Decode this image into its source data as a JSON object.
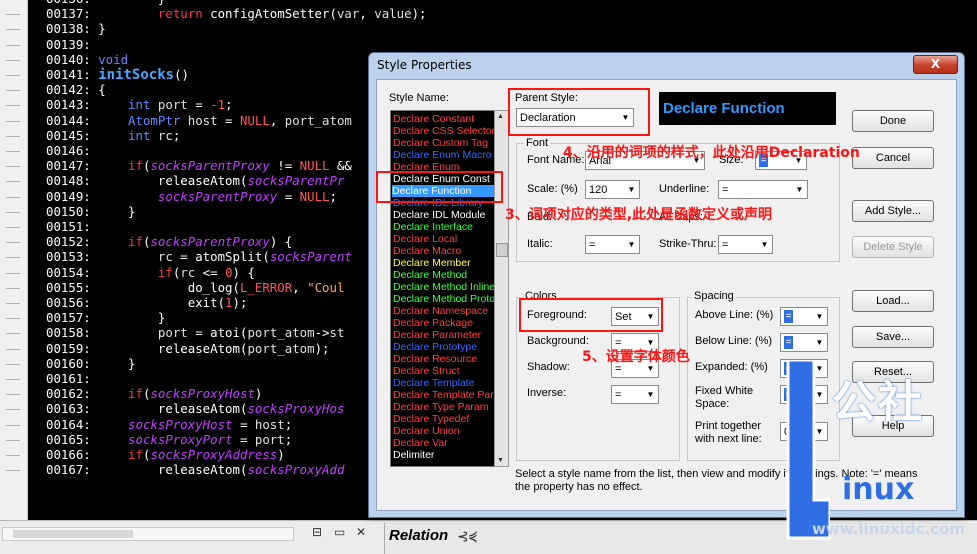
{
  "editor": {
    "lines": [
      {
        "n": "00136:",
        "parts": [
          {
            "c": "plain",
            "t": "        }"
          }
        ]
      },
      {
        "n": "00137:",
        "parts": [
          {
            "c": "kw",
            "t": "        return "
          },
          {
            "c": "fn",
            "t": "configAtomSetter"
          },
          {
            "c": "plain",
            "t": "("
          },
          {
            "c": "id",
            "t": "var"
          },
          {
            "c": "plain",
            "t": ", "
          },
          {
            "c": "id",
            "t": "value"
          },
          {
            "c": "plain",
            "t": ");"
          }
        ]
      },
      {
        "n": "00138:",
        "parts": [
          {
            "c": "plain",
            "t": "}"
          }
        ]
      },
      {
        "n": "00139:",
        "parts": [
          {
            "c": "plain",
            "t": ""
          }
        ]
      },
      {
        "n": "00140:",
        "parts": [
          {
            "c": "ty",
            "t": "void"
          }
        ]
      },
      {
        "n": "00141:",
        "parts": [
          {
            "c": "fdecl",
            "t": "initSocks"
          },
          {
            "c": "plain",
            "t": "()"
          }
        ]
      },
      {
        "n": "00142:",
        "parts": [
          {
            "c": "plain",
            "t": "{"
          }
        ]
      },
      {
        "n": "00143:",
        "parts": [
          {
            "c": "ty",
            "t": "    int "
          },
          {
            "c": "id",
            "t": "port"
          },
          {
            "c": "plain",
            "t": " = "
          },
          {
            "c": "num",
            "t": "-1"
          },
          {
            "c": "plain",
            "t": ";"
          }
        ]
      },
      {
        "n": "00144:",
        "parts": [
          {
            "c": "ty",
            "t": "    AtomPtr "
          },
          {
            "c": "id",
            "t": "host"
          },
          {
            "c": "plain",
            "t": " = "
          },
          {
            "c": "lit",
            "t": "NULL"
          },
          {
            "c": "plain",
            "t": ", "
          },
          {
            "c": "id",
            "t": "port_atom"
          }
        ]
      },
      {
        "n": "00145:",
        "parts": [
          {
            "c": "ty",
            "t": "    int "
          },
          {
            "c": "id",
            "t": "rc"
          },
          {
            "c": "plain",
            "t": ";"
          }
        ]
      },
      {
        "n": "00146:",
        "parts": [
          {
            "c": "plain",
            "t": ""
          }
        ]
      },
      {
        "n": "00147:",
        "parts": [
          {
            "c": "kw",
            "t": "    if"
          },
          {
            "c": "plain",
            "t": "("
          },
          {
            "c": "var",
            "t": "socksParentProxy"
          },
          {
            "c": "plain",
            "t": " != "
          },
          {
            "c": "lit",
            "t": "NULL"
          },
          {
            "c": "plain",
            "t": " &&"
          }
        ]
      },
      {
        "n": "00148:",
        "parts": [
          {
            "c": "fn",
            "t": "        releaseAtom"
          },
          {
            "c": "plain",
            "t": "("
          },
          {
            "c": "var",
            "t": "socksParentPr"
          }
        ]
      },
      {
        "n": "00149:",
        "parts": [
          {
            "c": "var",
            "t": "        socksParentProxy"
          },
          {
            "c": "plain",
            "t": " = "
          },
          {
            "c": "lit",
            "t": "NULL"
          },
          {
            "c": "plain",
            "t": ";"
          }
        ]
      },
      {
        "n": "00150:",
        "parts": [
          {
            "c": "plain",
            "t": "    }"
          }
        ]
      },
      {
        "n": "00151:",
        "parts": [
          {
            "c": "plain",
            "t": ""
          }
        ]
      },
      {
        "n": "00152:",
        "parts": [
          {
            "c": "kw",
            "t": "    if"
          },
          {
            "c": "plain",
            "t": "("
          },
          {
            "c": "var",
            "t": "socksParentProxy"
          },
          {
            "c": "plain",
            "t": ") {"
          }
        ]
      },
      {
        "n": "00153:",
        "parts": [
          {
            "c": "id",
            "t": "        rc"
          },
          {
            "c": "plain",
            "t": " = "
          },
          {
            "c": "fn",
            "t": "atomSplit"
          },
          {
            "c": "plain",
            "t": "("
          },
          {
            "c": "var",
            "t": "socksParent"
          }
        ]
      },
      {
        "n": "00154:",
        "parts": [
          {
            "c": "kw",
            "t": "        if"
          },
          {
            "c": "plain",
            "t": "("
          },
          {
            "c": "id",
            "t": "rc"
          },
          {
            "c": "plain",
            "t": " <= "
          },
          {
            "c": "num",
            "t": "0"
          },
          {
            "c": "plain",
            "t": ") {"
          }
        ]
      },
      {
        "n": "00155:",
        "parts": [
          {
            "c": "fn",
            "t": "            do_log"
          },
          {
            "c": "plain",
            "t": "("
          },
          {
            "c": "lit",
            "t": "L_ERROR"
          },
          {
            "c": "plain",
            "t": ", "
          },
          {
            "c": "str",
            "t": "\"Coul"
          }
        ]
      },
      {
        "n": "00156:",
        "parts": [
          {
            "c": "fn",
            "t": "            exit"
          },
          {
            "c": "plain",
            "t": "("
          },
          {
            "c": "num",
            "t": "1"
          },
          {
            "c": "plain",
            "t": ");"
          }
        ]
      },
      {
        "n": "00157:",
        "parts": [
          {
            "c": "plain",
            "t": "        }"
          }
        ]
      },
      {
        "n": "00158:",
        "parts": [
          {
            "c": "id",
            "t": "        port"
          },
          {
            "c": "plain",
            "t": " = "
          },
          {
            "c": "fn",
            "t": "atoi"
          },
          {
            "c": "plain",
            "t": "("
          },
          {
            "c": "id",
            "t": "port_atom"
          },
          {
            "c": "plain",
            "t": "->"
          },
          {
            "c": "id",
            "t": "st"
          }
        ]
      },
      {
        "n": "00159:",
        "parts": [
          {
            "c": "fn",
            "t": "        releaseAtom"
          },
          {
            "c": "plain",
            "t": "("
          },
          {
            "c": "id",
            "t": "port_atom"
          },
          {
            "c": "plain",
            "t": ");"
          }
        ]
      },
      {
        "n": "00160:",
        "parts": [
          {
            "c": "plain",
            "t": "    }"
          }
        ]
      },
      {
        "n": "00161:",
        "parts": [
          {
            "c": "plain",
            "t": ""
          }
        ]
      },
      {
        "n": "00162:",
        "parts": [
          {
            "c": "kw",
            "t": "    if"
          },
          {
            "c": "plain",
            "t": "("
          },
          {
            "c": "var",
            "t": "socksProxyHost"
          },
          {
            "c": "plain",
            "t": ")"
          }
        ]
      },
      {
        "n": "00163:",
        "parts": [
          {
            "c": "fn",
            "t": "        releaseAtom"
          },
          {
            "c": "plain",
            "t": "("
          },
          {
            "c": "var",
            "t": "socksProxyHos"
          }
        ]
      },
      {
        "n": "00164:",
        "parts": [
          {
            "c": "var",
            "t": "    socksProxyHost"
          },
          {
            "c": "plain",
            "t": " = "
          },
          {
            "c": "id",
            "t": "host"
          },
          {
            "c": "plain",
            "t": ";"
          }
        ]
      },
      {
        "n": "00165:",
        "parts": [
          {
            "c": "var",
            "t": "    socksProxyPort"
          },
          {
            "c": "plain",
            "t": " = "
          },
          {
            "c": "id",
            "t": "port"
          },
          {
            "c": "plain",
            "t": ";"
          }
        ]
      },
      {
        "n": "00166:",
        "parts": [
          {
            "c": "kw",
            "t": "    if"
          },
          {
            "c": "plain",
            "t": "("
          },
          {
            "c": "var",
            "t": "socksProxyAddress"
          },
          {
            "c": "plain",
            "t": ")"
          }
        ]
      },
      {
        "n": "00167:",
        "parts": [
          {
            "c": "fn",
            "t": "        releaseAtom"
          },
          {
            "c": "plain",
            "t": "("
          },
          {
            "c": "var",
            "t": "socksProxyAdd"
          }
        ]
      }
    ]
  },
  "dialog": {
    "title": "Style Properties",
    "close_label": "X",
    "style_name_label": "Style Name:",
    "styles": [
      {
        "label": "Declare Constant",
        "color": "#ff4040"
      },
      {
        "label": "Declare CSS Selector",
        "color": "#ff4040"
      },
      {
        "label": "Declare Custom Tag",
        "color": "#ff4040"
      },
      {
        "label": "Declare Enum Macro",
        "color": "#2f6bff"
      },
      {
        "label": "Declare Enum",
        "color": "#ff4040"
      },
      {
        "label": "Declare Enum Const",
        "color": "#ffffff"
      },
      {
        "label": "Declare Function",
        "color": "#ffffff",
        "selected": true
      },
      {
        "label": "Declare IDL Library",
        "color": "#2f6bff"
      },
      {
        "label": "Declare IDL Module",
        "color": "#ffffff"
      },
      {
        "label": "Declare Interface",
        "color": "#3cff3c"
      },
      {
        "label": "Declare Local",
        "color": "#ff4040"
      },
      {
        "label": "Declare Macro",
        "color": "#ff4040"
      },
      {
        "label": "Declare Member",
        "color": "#ffff40"
      },
      {
        "label": "Declare Method",
        "color": "#3cff3c"
      },
      {
        "label": "Declare Method Inline",
        "color": "#3cff3c"
      },
      {
        "label": "Declare Method Proto",
        "color": "#3cff3c"
      },
      {
        "label": "Declare Namespace",
        "color": "#ff4040"
      },
      {
        "label": "Declare Package",
        "color": "#ff4040"
      },
      {
        "label": "Declare Parameter",
        "color": "#ff4040"
      },
      {
        "label": "Declare Prototype",
        "color": "#2f6bff"
      },
      {
        "label": "Declare Resource",
        "color": "#ff4040"
      },
      {
        "label": "Declare Struct",
        "color": "#ff4040"
      },
      {
        "label": "Declare Template",
        "color": "#2f6bff"
      },
      {
        "label": "Declare Template Param",
        "color": "#ff4040"
      },
      {
        "label": "Declare Type Param",
        "color": "#ff4040"
      },
      {
        "label": "Declare Typedef",
        "color": "#ff4040"
      },
      {
        "label": "Declare Union",
        "color": "#ff4040"
      },
      {
        "label": "Declare Var",
        "color": "#ff4040"
      },
      {
        "label": "Delimiter",
        "color": "#ffffff"
      }
    ],
    "parent_style_label": "Parent Style:",
    "parent_style_value": "Declaration",
    "preview_text": "Declare Function",
    "font_group": "Font",
    "font_name_label": "Font Name:",
    "font_name_value": "Arial",
    "size_label": "Size:",
    "size_value": "=",
    "scale_label": "Scale: (%)",
    "scale_value": "120",
    "underline_label": "Underline:",
    "underline_value": "=",
    "bold_label": "Bold:",
    "allcaps_label": "All Caps:",
    "italic_label": "Italic:",
    "italic_value": "=",
    "strike_label": "Strike-Thru:",
    "strike_value": "=",
    "colors_group": "Colors",
    "foreground_label": "Foreground:",
    "foreground_value": "Set",
    "background_label": "Background:",
    "background_value": "=",
    "shadow_label": "Shadow:",
    "shadow_value": "=",
    "inverse_label": "Inverse:",
    "inverse_value": "=",
    "spacing_group": "Spacing",
    "above_label": "Above Line: (%)",
    "below_label": "Below Line: (%)",
    "expanded_label": "Expanded: (%)",
    "fixed_white_label": "Fixed White\nSpace:",
    "print_together_label": "Print together\nwith next line:",
    "spacing_value": "=",
    "print_together_value": "0",
    "buttons": {
      "done": "Done",
      "cancel": "Cancel",
      "add_style": "Add Style...",
      "delete_style": "Delete Style",
      "load": "Load...",
      "save": "Save...",
      "reset": "Reset...",
      "help": "Help"
    },
    "footer_note": "Select a style name from the list, then view and modify its settings. Note: '=' means the property has no effect."
  },
  "annotations": {
    "a3": "3、词项对应的类型,此处是函数定义或声明",
    "a4": "4、沿用的词项的样式，此处沿用Declaration",
    "a5": "5、设置字体颜色",
    "color": "#ff1414"
  },
  "statusbar": {
    "relation_label": "Relation"
  },
  "watermark": {
    "gongshe": "公社",
    "linux": "inux",
    "site": "www.linuxidc.com",
    "brand_color": "#2f6fe3"
  }
}
